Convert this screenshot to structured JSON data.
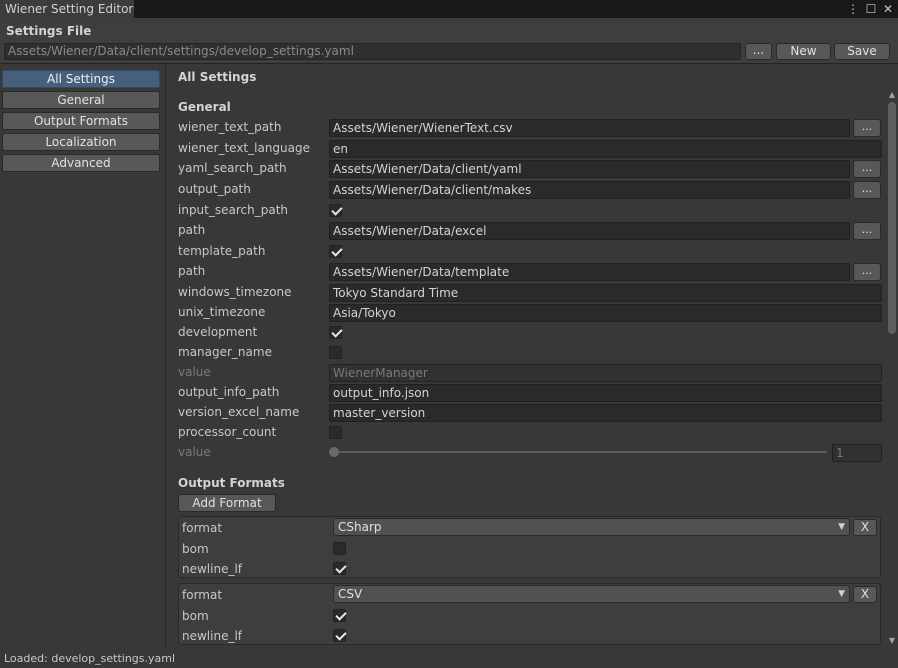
{
  "window": {
    "tab_title": "Wiener Setting Editor",
    "controls": [
      "⋮",
      "☐",
      "✕"
    ]
  },
  "settings_file": {
    "label": "Settings File",
    "path": "Assets/Wiener/Data/client/settings/develop_settings.yaml",
    "browse_label": "...",
    "new_label": "New",
    "save_label": "Save"
  },
  "sidebar": {
    "items": [
      {
        "label": "All Settings",
        "active": true
      },
      {
        "label": "General",
        "active": false
      },
      {
        "label": "Output Formats",
        "active": false
      },
      {
        "label": "Localization",
        "active": false
      },
      {
        "label": "Advanced",
        "active": false
      }
    ]
  },
  "main": {
    "title": "All Settings",
    "general_heading": "General",
    "rows": {
      "wiener_text_path": {
        "label": "wiener_text_path",
        "value": "Assets/Wiener/WienerText.csv",
        "browse": "..."
      },
      "wiener_text_language": {
        "label": "wiener_text_language",
        "value": "en"
      },
      "yaml_search_path": {
        "label": "yaml_search_path",
        "value": "Assets/Wiener/Data/client/yaml",
        "browse": "..."
      },
      "output_path": {
        "label": "output_path",
        "value": "Assets/Wiener/Data/client/makes",
        "browse": "..."
      },
      "input_search_path": {
        "label": "input_search_path",
        "checked": true
      },
      "input_path": {
        "label": "path",
        "value": "Assets/Wiener/Data/excel",
        "browse": "..."
      },
      "template_path": {
        "label": "template_path",
        "checked": true
      },
      "template_path_value": {
        "label": "path",
        "value": "Assets/Wiener/Data/template",
        "browse": "..."
      },
      "windows_timezone": {
        "label": "windows_timezone",
        "value": "Tokyo Standard Time"
      },
      "unix_timezone": {
        "label": "unix_timezone",
        "value": "Asia/Tokyo"
      },
      "development": {
        "label": "development",
        "checked": true
      },
      "manager_name": {
        "label": "manager_name",
        "checked": false
      },
      "manager_value": {
        "label": "value",
        "value": "WienerManager"
      },
      "output_info_path": {
        "label": "output_info_path",
        "value": "output_info.json"
      },
      "version_excel_name": {
        "label": "version_excel_name",
        "value": "master_version"
      },
      "processor_count": {
        "label": "processor_count",
        "checked": false
      },
      "processor_value": {
        "label": "value",
        "value": "1",
        "slider_fraction": 0
      }
    },
    "output_formats": {
      "heading": "Output Formats",
      "add_label": "Add Format",
      "items": [
        {
          "format_label": "format",
          "format": "CSharp",
          "remove": "X",
          "bom_label": "bom",
          "bom": false,
          "newline_label": "newline_lf",
          "newline_lf": true
        },
        {
          "format_label": "format",
          "format": "CSV",
          "remove": "X",
          "bom_label": "bom",
          "bom": true,
          "newline_label": "newline_lf",
          "newline_lf": true
        }
      ]
    }
  },
  "status": {
    "text": "Loaded: develop_settings.yaml"
  }
}
